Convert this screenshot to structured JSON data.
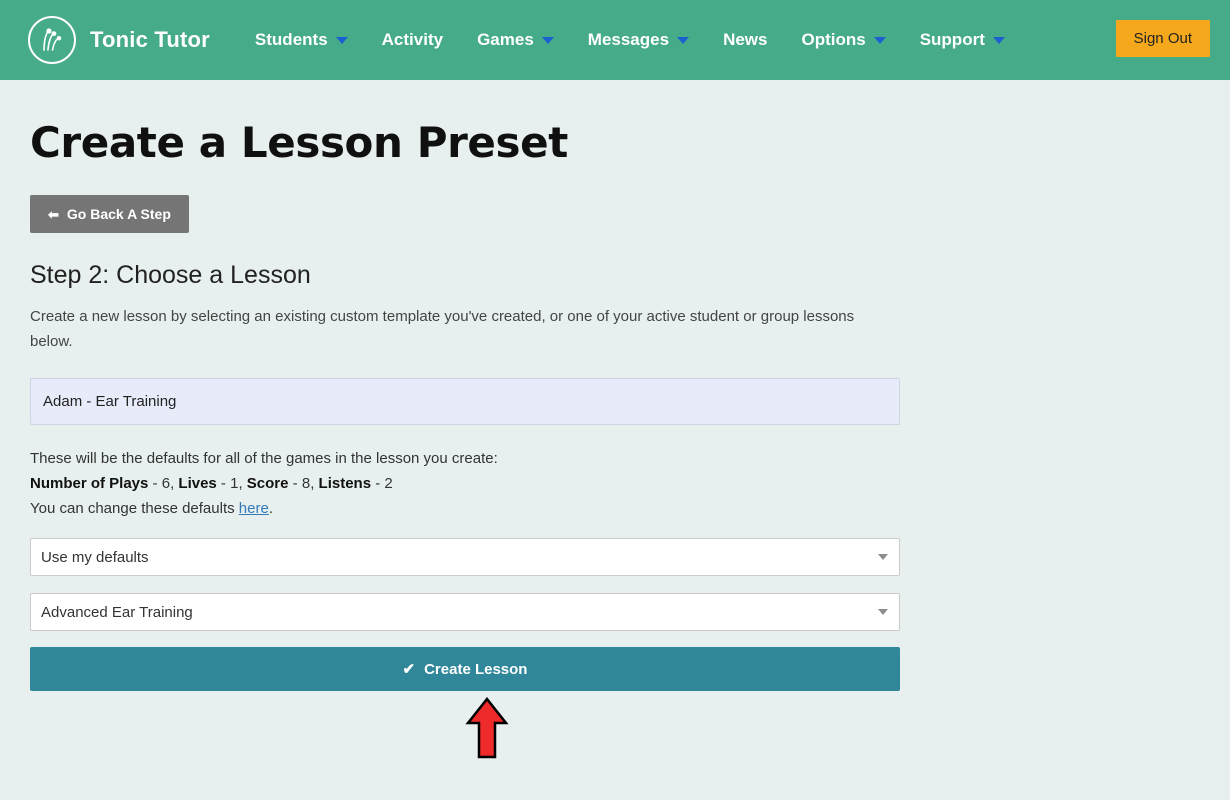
{
  "navbar": {
    "logo_icon": "tonic-tutor-logo-icon",
    "brand": "Tonic Tutor",
    "links": [
      {
        "label": "Students",
        "has_caret": true
      },
      {
        "label": "Activity",
        "has_caret": false
      },
      {
        "label": "Games",
        "has_caret": true
      },
      {
        "label": "Messages",
        "has_caret": true
      },
      {
        "label": "News",
        "has_caret": false
      },
      {
        "label": "Options",
        "has_caret": true
      },
      {
        "label": "Support",
        "has_caret": true
      }
    ],
    "sign_out_label": "Sign Out",
    "background_color": "#45ab88",
    "caret_color": "#1c5fd0",
    "sign_out_color": "#f5a81c"
  },
  "page": {
    "title": "Create a Lesson Preset",
    "background_color": "#e7efef"
  },
  "go_back": {
    "label": "Go Back A Step",
    "icon": "arrow-left-icon",
    "glyph": "⬅",
    "color": "#757575"
  },
  "step": {
    "heading": "Step 2: Choose a Lesson",
    "description": "Create a new lesson by selecting an existing custom template you've created, or one of your active student or group lessons below."
  },
  "lesson_item": {
    "label": "Adam - Ear Training",
    "background_color": "#e8ecfa"
  },
  "defaults": {
    "intro": "These will be the defaults for all of the games in the lesson you create:",
    "items": [
      {
        "label": "Number of Plays",
        "separator": " - ",
        "value": "6"
      },
      {
        "label": "Lives",
        "separator": " - ",
        "value": "1"
      },
      {
        "label": "Score",
        "separator": " - ",
        "value": "8"
      },
      {
        "label": "Listens",
        "separator": " - ",
        "value": "2"
      }
    ],
    "line_prefix": "Number of Plays",
    "change_text_before": "You can change these defaults ",
    "change_link": "here",
    "change_text_after": ".",
    "link_color": "#337ab7"
  },
  "selects": [
    {
      "name": "defaults-select",
      "value": "Use my defaults",
      "caret_icon": "chevron-down-icon"
    },
    {
      "name": "lesson-type-select",
      "value": "Advanced Ear Training",
      "caret_icon": "chevron-down-icon"
    }
  ],
  "create_button": {
    "label": "Create Lesson",
    "icon": "check-icon",
    "glyph": "✔",
    "color": "#2f8799"
  },
  "annotation": {
    "icon": "red-up-arrow-annotation",
    "fill_color": "#ef2a2a",
    "stroke_color": "#000000"
  }
}
